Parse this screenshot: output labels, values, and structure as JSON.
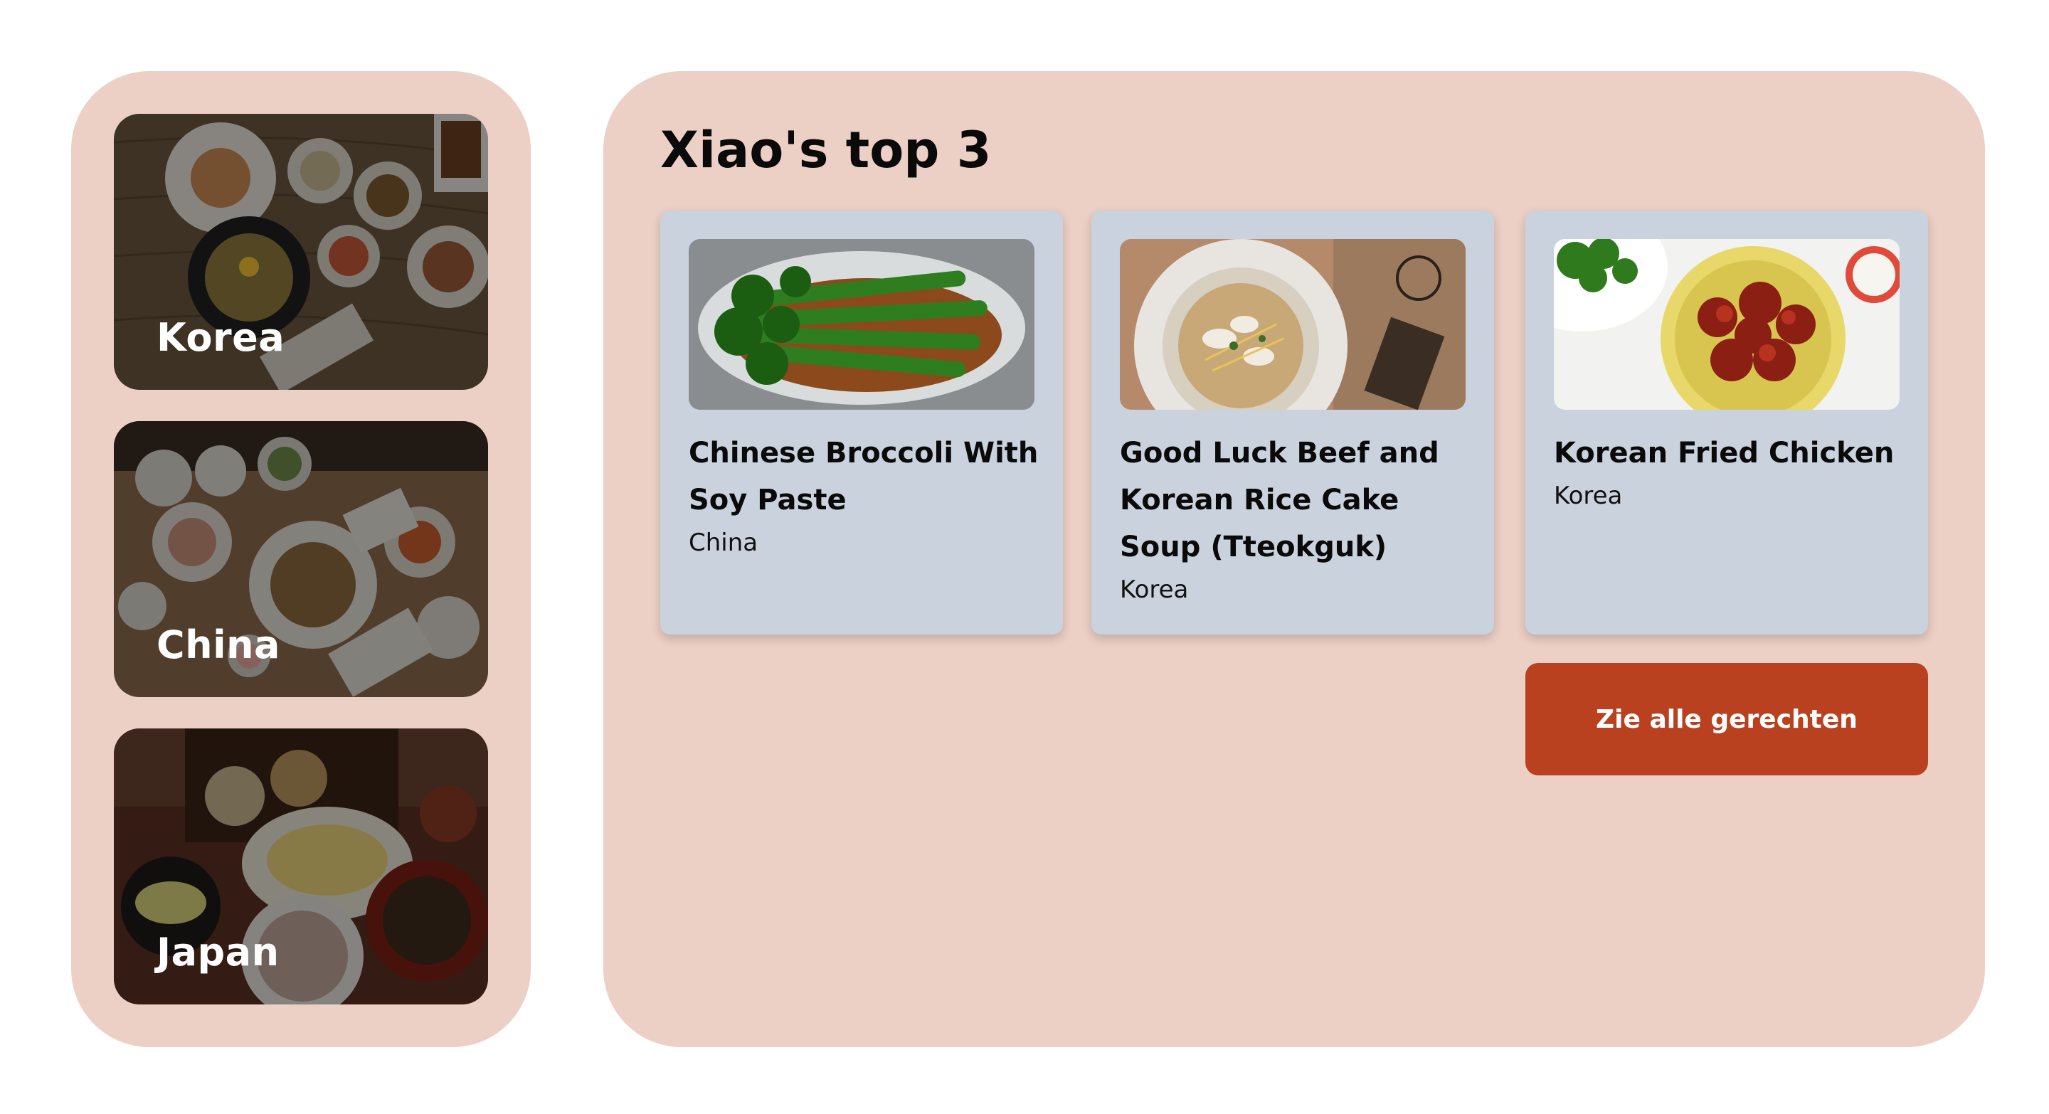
{
  "countries": [
    {
      "label": "Korea"
    },
    {
      "label": "China"
    },
    {
      "label": "Japan"
    }
  ],
  "top": {
    "title": "Xiao's top 3",
    "dishes": [
      {
        "name": "Chinese Broccoli With Soy Paste",
        "country": "China"
      },
      {
        "name": "Good Luck Beef and Korean Rice Cake Soup (Tteokguk)",
        "country": "Korea"
      },
      {
        "name": "Korean Fried Chicken",
        "country": "Korea"
      }
    ],
    "all_button": "Zie alle gerechten"
  }
}
